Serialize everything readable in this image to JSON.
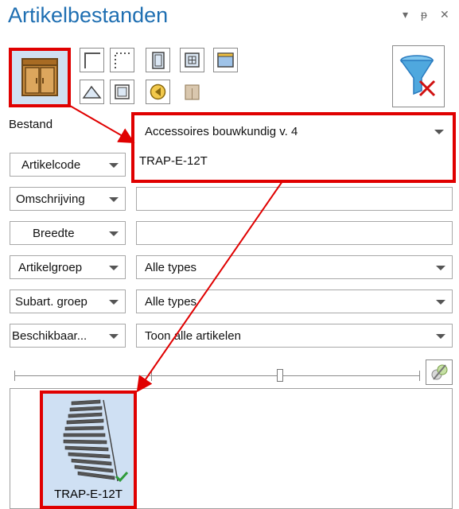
{
  "panel": {
    "title": "Artikelbestanden",
    "controls": [
      "▾",
      "ᵽ",
      "✕"
    ]
  },
  "icons": {
    "big": "cabinet-icon",
    "filter": "filter-clear-icon",
    "slider_action": "group-link-icon"
  },
  "form": {
    "bestand_label": "Bestand",
    "bestand_value": "Accessoires bouwkundig v. 4",
    "fields": [
      {
        "label": "Artikelcode",
        "value": "TRAP-E-12T",
        "kind": "text"
      },
      {
        "label": "Omschrijving",
        "value": "",
        "kind": "text"
      },
      {
        "label": "Breedte",
        "value": "",
        "kind": "text"
      },
      {
        "label": "Artikelgroep",
        "value": "Alle types",
        "kind": "select"
      },
      {
        "label": "Subart. groep",
        "value": "Alle types",
        "kind": "select"
      },
      {
        "label": "Beschikbaar...",
        "value": "Toon alle artikelen",
        "kind": "select"
      }
    ]
  },
  "results": {
    "items": [
      {
        "label": "TRAP-E-12T"
      }
    ]
  },
  "colors": {
    "title": "#1f6fb2",
    "highlight": "#e00000"
  }
}
